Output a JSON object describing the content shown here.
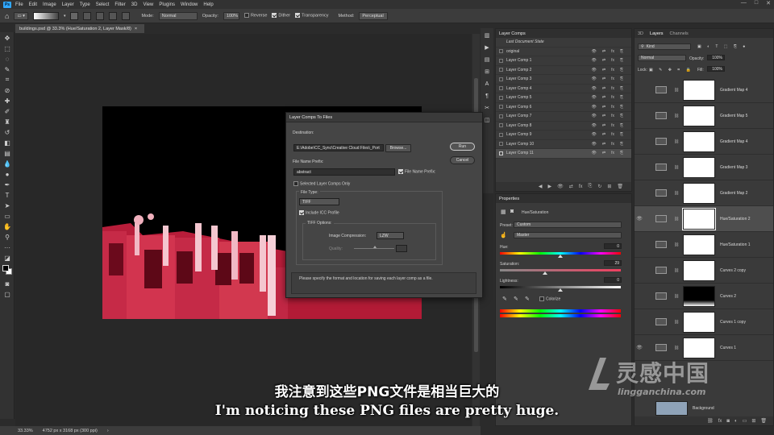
{
  "menubar": {
    "logo": "Ps",
    "items": [
      "File",
      "Edit",
      "Image",
      "Layer",
      "Type",
      "Select",
      "Filter",
      "3D",
      "View",
      "Plugins",
      "Window",
      "Help"
    ],
    "controls": [
      "—",
      "□",
      "✕"
    ]
  },
  "options": {
    "mode_label": "Mode:",
    "mode_value": "Normal",
    "opacity_label": "Opacity:",
    "opacity_value": "100%",
    "reverse": "Reverse",
    "dither": "Dither",
    "transparency": "Transparency",
    "method_label": "Method:",
    "method_value": "Perceptual"
  },
  "document": {
    "tab_title": "buildings.psd @ 33.3% (Hue/Saturation 2, Layer Mask/8)",
    "tab_close": "×",
    "zoom": "33.33%",
    "size": "4752 px x 3168 px (300 ppi)"
  },
  "dialog": {
    "title": "Layer Comps To Files",
    "destination_label": "Destination:",
    "destination_value": "E:\\Adobe\\CC_Sync\\Creative Cloud Files\\_Port",
    "browse_label": "Browse...",
    "run_label": "Run",
    "cancel_label": "Cancel",
    "prefix_label": "File Name Prefix:",
    "prefix_value": "abstract",
    "use_prefix_label": "File Name Prefix:",
    "selected_only_label": "Selected Layer Comps Only",
    "file_type_label": "File Type:",
    "file_type_value": "TIFF",
    "icc_label": "Include ICC Profile",
    "tiff_options_label": "TIFF Options:",
    "compression_label": "Image Compression:",
    "compression_value": "LZW",
    "quality_label": "Quality:",
    "message": "Please specify the format and location for saving each layer comp as a file."
  },
  "layer_comps": {
    "title": "Layer Comps",
    "items": [
      "Last Document State",
      "original",
      "Layer Comp 1",
      "Layer Comp 2",
      "Layer Comp 3",
      "Layer Comp 4",
      "Layer Comp 5",
      "Layer Comp 6",
      "Layer Comp 7",
      "Layer Comp 8",
      "Layer Comp 9",
      "Layer Comp 10",
      "Layer Comp 11"
    ],
    "selected": "Layer Comp 11"
  },
  "properties": {
    "title": "Properties",
    "adjustment": "Hue/Saturation",
    "preset_label": "Preset:",
    "preset_value": "Custom",
    "channel_value": "Master",
    "hue_label": "Hue:",
    "hue_value": "0",
    "saturation_label": "Saturation:",
    "saturation_value": "29",
    "lightness_label": "Lightness:",
    "lightness_value": "0",
    "colorize_label": "Colorize"
  },
  "layers": {
    "tabs": [
      "3D",
      "Layers",
      "Channels"
    ],
    "active_tab": "Layers",
    "kind_label": "Kind",
    "blend_value": "Normal",
    "opacity_label": "Opacity:",
    "opacity_value": "100%",
    "lock_label": "Lock:",
    "fill_label": "Fill:",
    "fill_value": "100%",
    "items": [
      {
        "name": "Gradient Map 4",
        "visible": false,
        "mask": "white"
      },
      {
        "name": "Gradient Map 5",
        "visible": false,
        "mask": "white"
      },
      {
        "name": "Gradient Map 4",
        "visible": false,
        "mask": "white"
      },
      {
        "name": "Gradient Map 3",
        "visible": false,
        "mask": "white"
      },
      {
        "name": "Gradient Map 2",
        "visible": false,
        "mask": "white"
      },
      {
        "name": "Hue/Saturation 2",
        "visible": true,
        "mask": "white",
        "selected": true
      },
      {
        "name": "Hue/Saturation 1",
        "visible": false,
        "mask": "white"
      },
      {
        "name": "Curves 2 copy",
        "visible": false,
        "mask": "white"
      },
      {
        "name": "Curves 2",
        "visible": false,
        "mask": "black"
      },
      {
        "name": "Curves 1 copy",
        "visible": false,
        "mask": "white"
      },
      {
        "name": "Curves 1",
        "visible": true,
        "mask": "white"
      }
    ],
    "last_layer": "Background"
  },
  "subtitle": {
    "cn": "我注意到这些PNG文件是相当巨大的",
    "en": "I'm noticing these PNG files are pretty huge."
  },
  "watermark": {
    "brand": "灵感中国",
    "url": "lingganchina.com"
  }
}
